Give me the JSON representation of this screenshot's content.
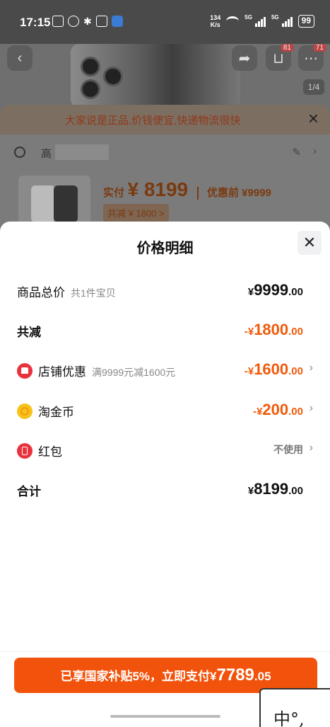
{
  "status_bar": {
    "time": "17:15",
    "net_speed_value": "134",
    "net_speed_unit": "K/s",
    "signal_1": "5G",
    "signal_2": "5G",
    "battery": "99"
  },
  "background_page": {
    "cart_badge": "81",
    "other_badge": "71",
    "image_counter": "1/4",
    "banner_text": "大家说是正品,价钱便宜,快递物流很快",
    "address_visible": "高",
    "paid_label": "实付",
    "paid_amount": "¥ 8199",
    "pre_discount": "优惠前 ¥9999",
    "reduced_tag": "共减 ¥ 1800 >"
  },
  "sheet": {
    "title": "价格明细",
    "rows": [
      {
        "label": "商品总价",
        "sub": "共1件宝贝",
        "currency": "¥",
        "int": "9999",
        "dec": ".00"
      },
      {
        "label": "共减",
        "sub": "",
        "currency": "-¥",
        "int": "1800",
        "dec": ".00"
      },
      {
        "label": "店铺优惠",
        "sub": "满9999元减1600元",
        "currency": "-¥",
        "int": "1600",
        "dec": ".00"
      },
      {
        "label": "淘金币",
        "sub": "",
        "currency": "-¥",
        "int": "200",
        "dec": ".00"
      },
      {
        "label": "红包",
        "sub": "",
        "value": "不使用"
      },
      {
        "label": "合计",
        "sub": "",
        "currency": "¥",
        "int": "8199",
        "dec": ".00"
      }
    ]
  },
  "pay_button": {
    "prefix": "已享国家补贴5%，立即支付",
    "currency": "¥",
    "int": "7789",
    "dec": ".05"
  },
  "ime_popup": "中°,"
}
